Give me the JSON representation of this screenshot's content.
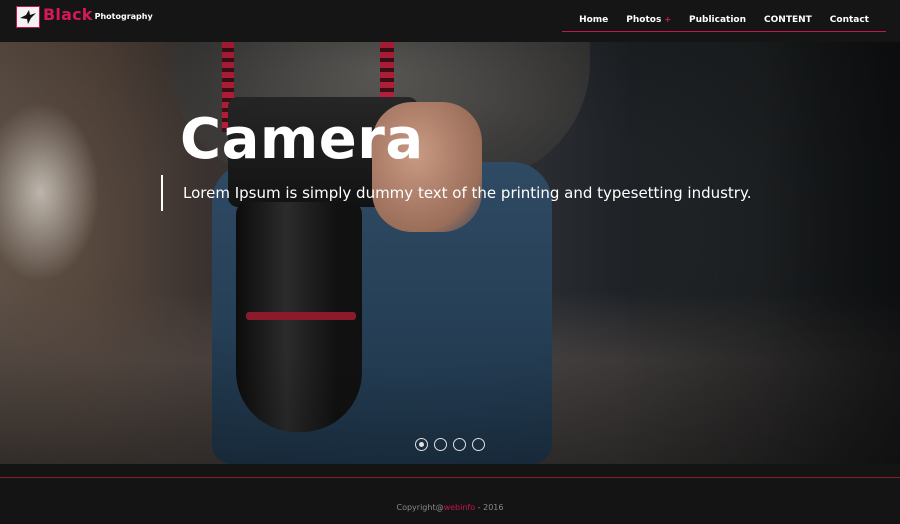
{
  "brand": {
    "word1": "Black",
    "word2": "Photography"
  },
  "nav": {
    "items": [
      {
        "label": "Home"
      },
      {
        "label": "Photos",
        "caret": "+"
      },
      {
        "label": "Publication"
      },
      {
        "label": "CONTENT"
      },
      {
        "label": "Contact"
      }
    ]
  },
  "hero": {
    "title": "Camera",
    "caption": "Lorem Ipsum is simply dummy text of the printing and typesetting industry.",
    "slides": 4,
    "active_slide": 1
  },
  "footer": {
    "prefix": "Copyright@",
    "link": "webinfo",
    "suffix": " - 2016"
  },
  "colors": {
    "accent": "#c4174f",
    "brand_red": "#d4185a",
    "header_bg": "#151515"
  },
  "icons": {
    "logo": "swallow-bird-icon"
  }
}
